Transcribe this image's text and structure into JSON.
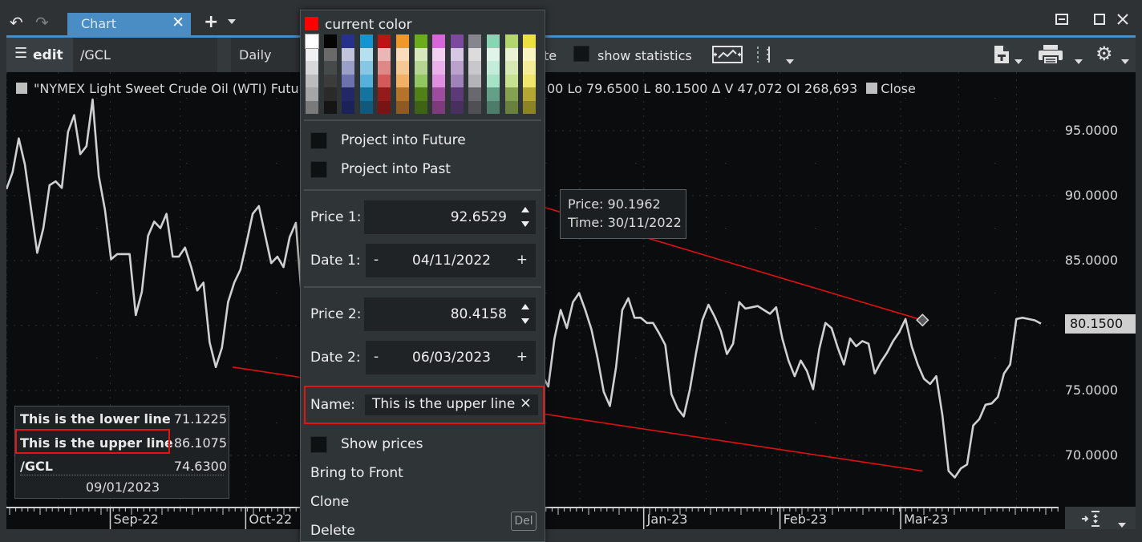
{
  "titlebar": {
    "back_icon": "undo-arrow-icon",
    "forward_icon": "redo-arrow-icon",
    "tab_label": "Chart",
    "tab_close": "✕",
    "new_tab": "+",
    "window_controls": [
      "restore-icon",
      "maximize-icon",
      "close-icon"
    ]
  },
  "toolbar": {
    "edit_label": "edit",
    "symbol": "/GCL",
    "period": "Daily",
    "hidden_label_tail": "te",
    "show_statistics": "show statistics",
    "show_statistics_checked": false
  },
  "chart": {
    "instrument_label": "\"NYMEX Light Sweet Crude Oil (WTI) Futu",
    "ohlc_tail": "00  Lo 79.6500  L 80.1500  Δ   V 47,072  OI 268,693",
    "close_label": "Close",
    "last_price": "80.1500",
    "tooltip": {
      "price": "Price: 90.1962",
      "time": "Time: 30/11/2022"
    }
  },
  "data_legend": {
    "rows": [
      {
        "name": "This is the lower line",
        "value": "71.1225"
      },
      {
        "name": "This is the upper line",
        "value": "86.1075"
      },
      {
        "name": "/GCL",
        "value": "74.6300"
      }
    ],
    "date": "09/01/2023"
  },
  "popup": {
    "current_color_label": "current color",
    "current_color": "#ff0000",
    "palette": [
      [
        "#ffffff",
        "#f0f0f0",
        "#d8d8d8",
        "#bcbcbc",
        "#a6a6a6",
        "#7a7a7a"
      ],
      [
        "#050505",
        "#6a6a6a",
        "#474a4b",
        "#3c3c3c",
        "#2a2a2a",
        "#151515"
      ],
      [
        "#27308a",
        "#c2c4dc",
        "#9a9fc8",
        "#6b72ad",
        "#212865",
        "#1b2257"
      ],
      [
        "#1494d0",
        "#b4e0f0",
        "#86c8e4",
        "#56b0dc",
        "#15749f",
        "#10597b"
      ],
      [
        "#c01212",
        "#eab6b6",
        "#e08888",
        "#d65959",
        "#951a1a",
        "#781414"
      ],
      [
        "#f0972a",
        "#f8dcbc",
        "#f6c894",
        "#f2b066",
        "#b4722a",
        "#8c5a22"
      ],
      [
        "#6aac1a",
        "#d6e8bc",
        "#b4d690",
        "#92c660",
        "#528018",
        "#3f6316"
      ],
      [
        "#d966d9",
        "#f2d0f2",
        "#eab0ea",
        "#e08ee0",
        "#9e4c9e",
        "#7c3c7c"
      ],
      [
        "#7b4a9e",
        "#d6c8e2",
        "#baa2cc",
        "#9e82b8",
        "#5c3a78",
        "#48305e"
      ],
      [
        "#86868e",
        "#dcdcdc",
        "#c8c8cc",
        "#b4b4b8",
        "#68686e",
        "#505054"
      ],
      [
        "#86d6b4",
        "#e0f4ea",
        "#c4ecda",
        "#a6e2c6",
        "#64a088",
        "#4e7c6a"
      ],
      [
        "#b4d66e",
        "#eaf2d4",
        "#d8eab4",
        "#c6e290",
        "#86a052",
        "#6a8040"
      ],
      [
        "#ece040",
        "#f8f4c0",
        "#f4ec98",
        "#f0e66e",
        "#b4a632",
        "#8c8228"
      ]
    ],
    "project_future": "Project into Future",
    "project_past": "Project into Past",
    "price1_label": "Price 1:",
    "price1": "92.6529",
    "date1_label": "Date 1:",
    "date1": "04/11/2022",
    "price2_label": "Price 2:",
    "price2": "80.4158",
    "date2_label": "Date 2:",
    "date2": "06/03/2023",
    "minus": "-",
    "plus": "+",
    "name_label": "Name:",
    "name_value": "This is the upper line",
    "name_clear": "×",
    "show_prices": "Show prices",
    "bring_to_front": "Bring to Front",
    "clone": "Clone",
    "delete": "Delete",
    "delete_shortcut": "Del"
  },
  "chart_data": {
    "type": "line",
    "title": "NYMEX Light Sweet Crude Oil (WTI) Futures",
    "xlabel": "",
    "ylabel": "",
    "ylim": [
      67.5,
      98.5
    ],
    "y_ticks": [
      "95.0000",
      "90.0000",
      "85.0000",
      "75.0000",
      "70.0000"
    ],
    "y_tick_values": [
      95,
      90,
      85,
      75,
      70
    ],
    "x_ticks": [
      {
        "label": "Sep-22",
        "t": 0.0987
      },
      {
        "label": "Oct-22",
        "t": 0.2274
      },
      {
        "label": "Jan-23",
        "t": 0.6057
      },
      {
        "label": "Feb-23",
        "t": 0.7352
      },
      {
        "label": "Mar-23",
        "t": 0.8499
      }
    ],
    "grid": true,
    "series": [
      {
        "name": "/GCL Close",
        "color": "#d0d0d0",
        "values": [
          90.5,
          91.8,
          94.4,
          92.4,
          89.0,
          85.6,
          87.5,
          90.8,
          91.1,
          90.6,
          94.9,
          96.2,
          93.2,
          93.8,
          97.4,
          91.5,
          88.9,
          85.1,
          85.5,
          85.5,
          85.5,
          80.8,
          82.6,
          86.9,
          88.0,
          87.5,
          88.6,
          85.3,
          85.3,
          86.0,
          84.5,
          82.7,
          83.3,
          78.7,
          76.8,
          78.3,
          81.8,
          83.3,
          84.3,
          86.4,
          88.6,
          89.2,
          87.0,
          84.8,
          85.3,
          84.5,
          86.8,
          87.9,
          81.8,
          80.4,
          80.1,
          81.6,
          79.8,
          82.8,
          82.2,
          80.4,
          81.6,
          81.6,
          80.4,
          79.4,
          80.5,
          81.4,
          80.6,
          77.2,
          75.4,
          76.4,
          76.4,
          77.6,
          78.4,
          78.8,
          81.0,
          82.0,
          83.0,
          82.3,
          84.3,
          86.2,
          86.6,
          85.8,
          84.0,
          83.2,
          83.4,
          81.4,
          80.8,
          82.3,
          81.4,
          78.7,
          77.3,
          76.2,
          75.3,
          79.0,
          81.2,
          79.8,
          81.8,
          82.5,
          81.2,
          79.7,
          77.5,
          74.9,
          73.8,
          76.8,
          81.2,
          82.1,
          80.6,
          80.6,
          80.2,
          80.2,
          79.4,
          78.5,
          74.7,
          73.6,
          73.0,
          75.1,
          77.9,
          80.4,
          81.6,
          80.7,
          79.6,
          77.8,
          78.6,
          81.8,
          81.3,
          81.4,
          81.5,
          81.2,
          80.9,
          81.4,
          79.0,
          77.3,
          76.1,
          77.3,
          76.5,
          75.1,
          78.2,
          80.2,
          79.8,
          78.3,
          77.0,
          79.0,
          78.4,
          78.8,
          78.6,
          76.3,
          77.2,
          77.9,
          78.8,
          79.5,
          80.5,
          78.4,
          77.0,
          75.9,
          75.5,
          76.1,
          73.1,
          68.8,
          68.3,
          69.0,
          69.3,
          72.3,
          72.8,
          73.9,
          74.0,
          74.5,
          76.3,
          77.0,
          80.5,
          80.6,
          80.5,
          80.4,
          80.15
        ]
      }
    ],
    "trendlines": [
      {
        "name": "This is the upper line",
        "color": "#e01010",
        "from": {
          "date": "04/11/2022",
          "price": 92.6529
        },
        "to": {
          "date": "06/03/2023",
          "price": 80.4158
        }
      },
      {
        "name": "This is the lower line",
        "color": "#e01010",
        "from": {
          "date": "29/09/2022",
          "price": 76.8
        },
        "to": {
          "date": "06/03/2023",
          "price": 68.8
        }
      }
    ],
    "last_value_label": "80.1500"
  },
  "xaxis_controls": {
    "fit_icon": "fit-to-screen-icon"
  }
}
